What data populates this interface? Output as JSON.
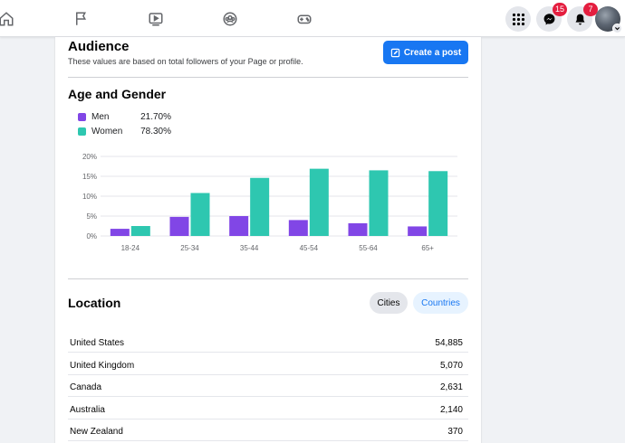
{
  "nav": {
    "icons": [
      "home-icon",
      "flag-icon",
      "video-icon",
      "groups-icon",
      "gaming-icon"
    ],
    "menu_icon": "grid-menu-icon",
    "messenger": {
      "icon": "messenger-icon",
      "badge": "15"
    },
    "notifications": {
      "icon": "bell-icon",
      "badge": "7"
    }
  },
  "audience": {
    "title": "Audience",
    "subtitle": "These values are based on total followers of your Page or profile.",
    "create_post_label": "Create a post"
  },
  "age_gender": {
    "title": "Age and Gender",
    "legend": [
      {
        "name": "Men",
        "value": "21.70%",
        "color": "#8146e6"
      },
      {
        "name": "Women",
        "value": "78.30%",
        "color": "#2ec7b0"
      }
    ]
  },
  "chart_data": {
    "type": "bar",
    "categories": [
      "18-24",
      "25-34",
      "35-44",
      "45-54",
      "55-64",
      "65+"
    ],
    "series": [
      {
        "name": "Men",
        "values": [
          1.8,
          4.8,
          5.0,
          4.0,
          3.2,
          2.4
        ],
        "color": "#8146e6"
      },
      {
        "name": "Women",
        "values": [
          2.5,
          10.8,
          14.6,
          16.9,
          16.5,
          16.3
        ],
        "color": "#2ec7b0"
      }
    ],
    "yticks": [
      "20%",
      "15%",
      "10%",
      "5%",
      "0%"
    ],
    "ylim": [
      0,
      20
    ],
    "grid": true
  },
  "location": {
    "title": "Location",
    "tabs": {
      "cities": "Cities",
      "countries": "Countries"
    },
    "rows": [
      {
        "name": "United States",
        "value": "54,885"
      },
      {
        "name": "United Kingdom",
        "value": "5,070"
      },
      {
        "name": "Canada",
        "value": "2,631"
      },
      {
        "name": "Australia",
        "value": "2,140"
      },
      {
        "name": "New Zealand",
        "value": "370"
      }
    ]
  }
}
